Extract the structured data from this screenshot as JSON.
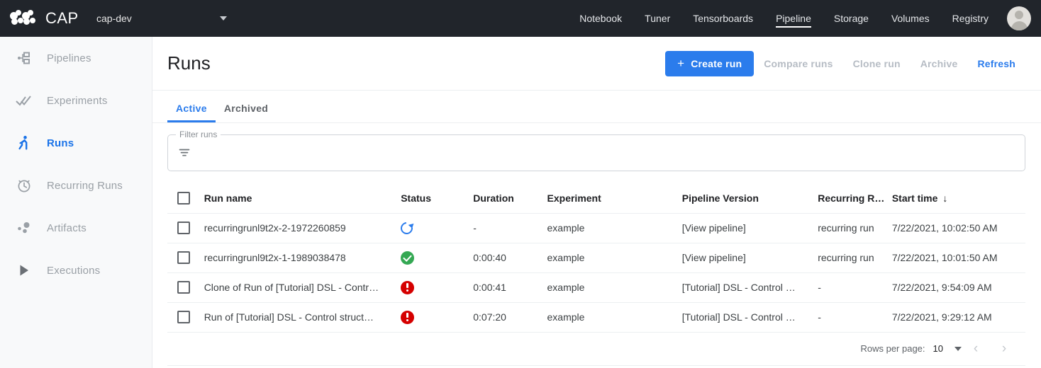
{
  "topbar": {
    "brand": "CAP",
    "namespace": "cap-dev",
    "namespace_caret_icon": "chevron-down-icon",
    "nav": [
      {
        "label": "Notebook",
        "active": false
      },
      {
        "label": "Tuner",
        "active": false
      },
      {
        "label": "Tensorboards",
        "active": false
      },
      {
        "label": "Pipeline",
        "active": true
      },
      {
        "label": "Storage",
        "active": false
      },
      {
        "label": "Volumes",
        "active": false
      },
      {
        "label": "Registry",
        "active": false
      }
    ],
    "avatar_icon": "user-avatar-icon"
  },
  "sidebar": {
    "items": [
      {
        "label": "Pipelines",
        "icon": "pipelines-icon",
        "active": false
      },
      {
        "label": "Experiments",
        "icon": "experiments-icon",
        "active": false
      },
      {
        "label": "Runs",
        "icon": "runs-icon",
        "active": true
      },
      {
        "label": "Recurring Runs",
        "icon": "clock-icon",
        "active": false
      },
      {
        "label": "Artifacts",
        "icon": "artifacts-icon",
        "active": false
      },
      {
        "label": "Executions",
        "icon": "executions-icon",
        "active": false
      }
    ]
  },
  "header": {
    "title": "Runs",
    "create_run_label": "Create run",
    "create_run_plus": "+",
    "compare_runs_label": "Compare runs",
    "clone_run_label": "Clone run",
    "archive_label": "Archive",
    "refresh_label": "Refresh"
  },
  "tabs": [
    {
      "label": "Active",
      "active": true
    },
    {
      "label": "Archived",
      "active": false
    }
  ],
  "filter": {
    "legend": "Filter runs",
    "value": "",
    "placeholder": "",
    "icon": "filter-icon"
  },
  "table": {
    "columns": [
      {
        "key": "name",
        "label": "Run name"
      },
      {
        "key": "status",
        "label": "Status"
      },
      {
        "key": "duration",
        "label": "Duration"
      },
      {
        "key": "experiment",
        "label": "Experiment"
      },
      {
        "key": "pipeline_version",
        "label": "Pipeline Version"
      },
      {
        "key": "recurring_run",
        "label": "Recurring R…"
      },
      {
        "key": "start_time",
        "label": "Start time"
      }
    ],
    "sort_arrow": "↓",
    "rows": [
      {
        "name": "recurringrunl9t2x-2-1972260859",
        "status_icon": "running-icon",
        "duration": "-",
        "experiment": "example",
        "pipeline_version": "[View pipeline]",
        "recurring_run": "recurring run",
        "start_time": "7/22/2021, 10:02:50 AM"
      },
      {
        "name": "recurringrunl9t2x-1-1989038478",
        "status_icon": "success-icon",
        "duration": "0:00:40",
        "experiment": "example",
        "pipeline_version": "[View pipeline]",
        "recurring_run": "recurring run",
        "start_time": "7/22/2021, 10:01:50 AM"
      },
      {
        "name": "Clone of Run of [Tutorial] DSL - Contr…",
        "status_icon": "error-icon",
        "duration": "0:00:41",
        "experiment": "example",
        "pipeline_version": "[Tutorial] DSL - Control …",
        "recurring_run": "-",
        "start_time": "7/22/2021, 9:54:09 AM"
      },
      {
        "name": "Run of [Tutorial] DSL - Control struct…",
        "status_icon": "error-icon",
        "duration": "0:07:20",
        "experiment": "example",
        "pipeline_version": "[Tutorial] DSL - Control …",
        "recurring_run": "-",
        "start_time": "7/22/2021, 9:29:12 AM"
      }
    ]
  },
  "pagination": {
    "rows_per_page_label": "Rows per page:",
    "rows_per_page_value": "10",
    "prev_icon": "chevron-left-icon",
    "next_icon": "chevron-right-icon",
    "prev_glyph": "‹",
    "next_glyph": "›"
  },
  "colors": {
    "topbar_bg": "#21252b",
    "accent_blue": "#2b7cec",
    "success_green": "#34a853",
    "error_red": "#d50000",
    "muted_gray": "#9aa0a6"
  }
}
